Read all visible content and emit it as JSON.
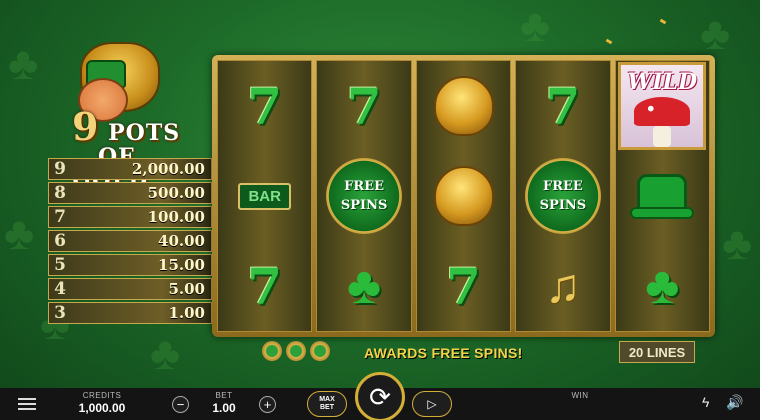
{
  "logo": {
    "number": "9",
    "title_line1": "POTS",
    "title_line2": "OF GOLD"
  },
  "paytable": [
    {
      "count": "9",
      "value": "2,000.00"
    },
    {
      "count": "8",
      "value": "500.00"
    },
    {
      "count": "7",
      "value": "100.00"
    },
    {
      "count": "6",
      "value": "40.00"
    },
    {
      "count": "5",
      "value": "15.00"
    },
    {
      "count": "4",
      "value": "5.00"
    },
    {
      "count": "3",
      "value": "1.00"
    }
  ],
  "reels": [
    [
      "seven",
      "bar",
      "seven"
    ],
    [
      "seven",
      "free-spins",
      "clover"
    ],
    [
      "pot-of-gold",
      "pot-of-gold",
      "seven"
    ],
    [
      "seven",
      "free-spins",
      "harp"
    ],
    [
      "wild",
      "hat",
      "clover"
    ]
  ],
  "symbols": {
    "seven": "7",
    "bar": "BAR",
    "free_spins_line1": "FREE",
    "free_spins_line2": "SPINS",
    "wild": "WILD",
    "clover": "♣",
    "harp": "♫"
  },
  "bonus_message": "AWARDS FREE SPINS!",
  "lines": "20 LINES",
  "bottom_bar": {
    "credits_label": "CREDITS",
    "credits_value": "1,000.00",
    "bet_label": "BET",
    "bet_value": "1.00",
    "win_label": "WIN",
    "minus": "−",
    "plus": "+",
    "max_bet_line1": "MAX",
    "max_bet_line2": "BET",
    "spin_icon": "⟳",
    "autoplay_icon": "▷",
    "turbo_icon": "ϟ",
    "sound_icon": "🔊"
  },
  "colors": {
    "accent_gold": "#d4af37",
    "message_yellow": "#f3d34a",
    "symbol_green": "#31c041"
  }
}
